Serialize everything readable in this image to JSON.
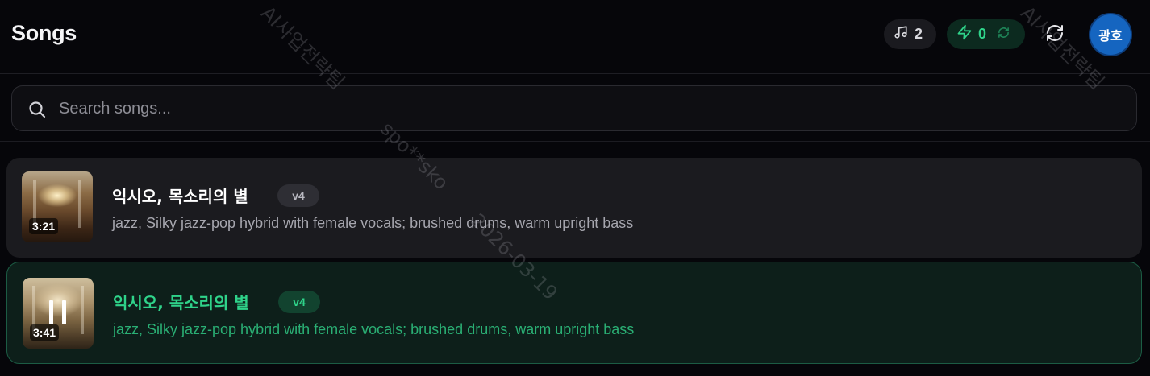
{
  "header": {
    "title": "Songs",
    "song_count": "2",
    "credits": "0",
    "avatar_text": "광호",
    "icons": {
      "song_count": "music-note-icon",
      "credits": "lightning-icon",
      "sync": "refresh-small-icon",
      "refresh": "refresh-icon"
    },
    "accent_color": "#2fd38a",
    "avatar_color": "#1565c0"
  },
  "search": {
    "placeholder": "Search songs...",
    "value": "",
    "icon": "search-icon"
  },
  "songs": [
    {
      "title": "익시오, 목소리의 별",
      "version": "v4",
      "duration": "3:21",
      "description": "jazz, Silky jazz-pop hybrid with female vocals; brushed drums, warm upright bass",
      "state": "idle"
    },
    {
      "title": "익시오, 목소리의 별",
      "version": "v4",
      "duration": "3:41",
      "description": "jazz, Silky jazz-pop hybrid with female vocals; brushed drums, warm upright bass",
      "state": "playing",
      "highlight_color": "#2fd38a"
    }
  ],
  "watermark": {
    "org": "AI사업전략팀",
    "user": "spo**sko",
    "date": "2026-03-19"
  }
}
